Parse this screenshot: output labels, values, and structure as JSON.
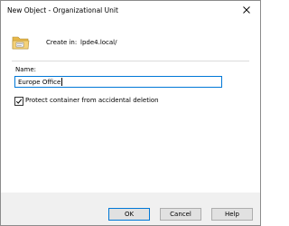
{
  "window": {
    "title": "New Object - Organizational Unit",
    "close_symbol": "close-icon"
  },
  "header": {
    "icon": "organizational-unit-folder-icon",
    "create_in_label": "Create in:",
    "create_in_value": "lpde4.local/"
  },
  "form": {
    "name_label": "Name:",
    "name_value": "Europe Office",
    "protect_checkbox": {
      "label": "Protect container from accidental deletion",
      "checked": true
    }
  },
  "buttons": {
    "ok_label": "OK",
    "cancel_label": "Cancel",
    "help_label": "Help"
  },
  "colors": {
    "focus_border": "#0078d7",
    "folder_yellow": "#f4d27a"
  }
}
